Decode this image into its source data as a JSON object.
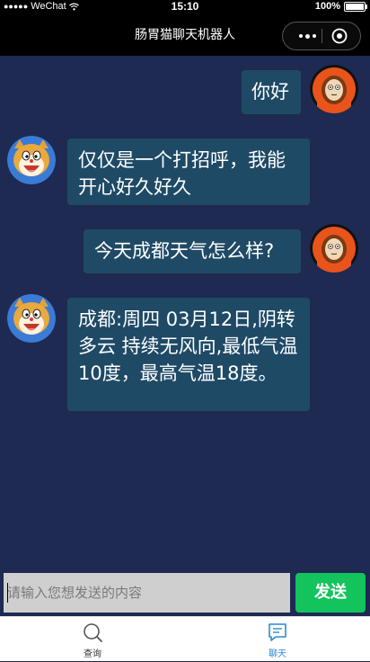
{
  "status_bar": {
    "carrier": "WeChat",
    "time": "15:10",
    "battery": "100%"
  },
  "nav": {
    "title": "肠胃猫聊天机器人"
  },
  "messages": [
    {
      "from": "user",
      "text": "你好"
    },
    {
      "from": "bot",
      "text": "仅仅是一个打招呼，我能开心好久好久"
    },
    {
      "from": "user",
      "text": "今天成都天气怎么样?"
    },
    {
      "from": "bot",
      "text": "成都:周四 03月12日,阴转多云 持续无风向,最低气温10度，最高气温18度。"
    }
  ],
  "input": {
    "placeholder": "请输入您想发送的内容",
    "value": ""
  },
  "send_label": "发送",
  "tabs": [
    {
      "label": "查询",
      "icon": "search-icon",
      "active": false
    },
    {
      "label": "聊天",
      "icon": "chat-icon",
      "active": true
    }
  ],
  "colors": {
    "chat_background": "#1e2a52",
    "bubble": "#1f4a66",
    "send_button": "#13c35c",
    "active_tab": "#2d8ad6"
  }
}
